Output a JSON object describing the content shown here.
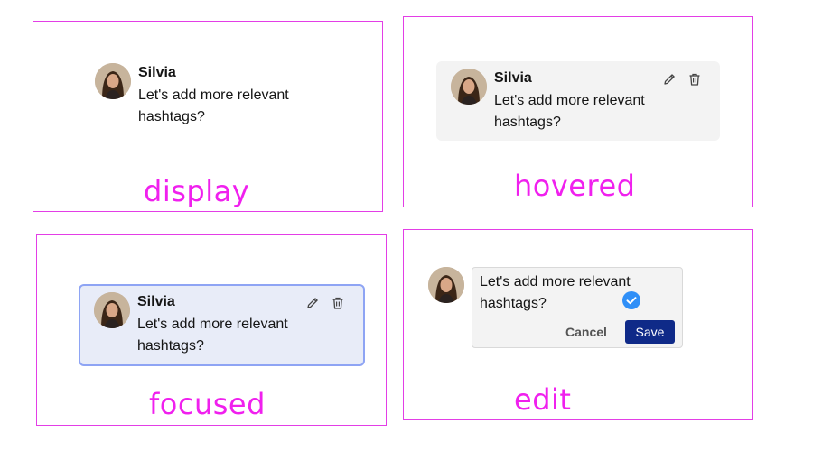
{
  "colors": {
    "annotation": "#f020ee",
    "hovered_bg": "#f3f3f3",
    "focused_bg": "#e8ecf8",
    "focused_border": "#8ea4f4",
    "save_bg": "#0f2a88",
    "check_bg": "#2f8ff7"
  },
  "states": {
    "display": {
      "label": "display",
      "author": "Silvia",
      "comment": "Let's add more relevant hashtags?"
    },
    "hovered": {
      "label": "hovered",
      "author": "Silvia",
      "comment": "Let's add more relevant hashtags?"
    },
    "focused": {
      "label": "focused",
      "author": "Silvia",
      "comment": "Let's add more relevant hashtags?"
    },
    "edit": {
      "label": "edit",
      "input_value": "Let's add more relevant hashtags?",
      "cancel_label": "Cancel",
      "save_label": "Save"
    }
  },
  "icons": {
    "edit": "pencil-icon",
    "delete": "trash-icon",
    "confirm": "check-circle-icon"
  }
}
